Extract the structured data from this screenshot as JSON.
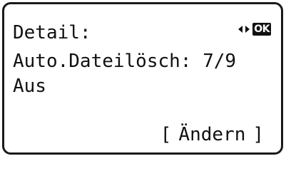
{
  "screen": {
    "title": "Detail:",
    "setting_label": "Auto.Dateilösch:",
    "page_indicator": "7/9",
    "value": "Aus",
    "nav": {
      "left_icon": "left-arrow-icon",
      "right_icon": "right-arrow-icon",
      "ok_label": "OK"
    },
    "softkey": {
      "open_bracket": "[",
      "label": "Ändern",
      "close_bracket": "]"
    }
  }
}
